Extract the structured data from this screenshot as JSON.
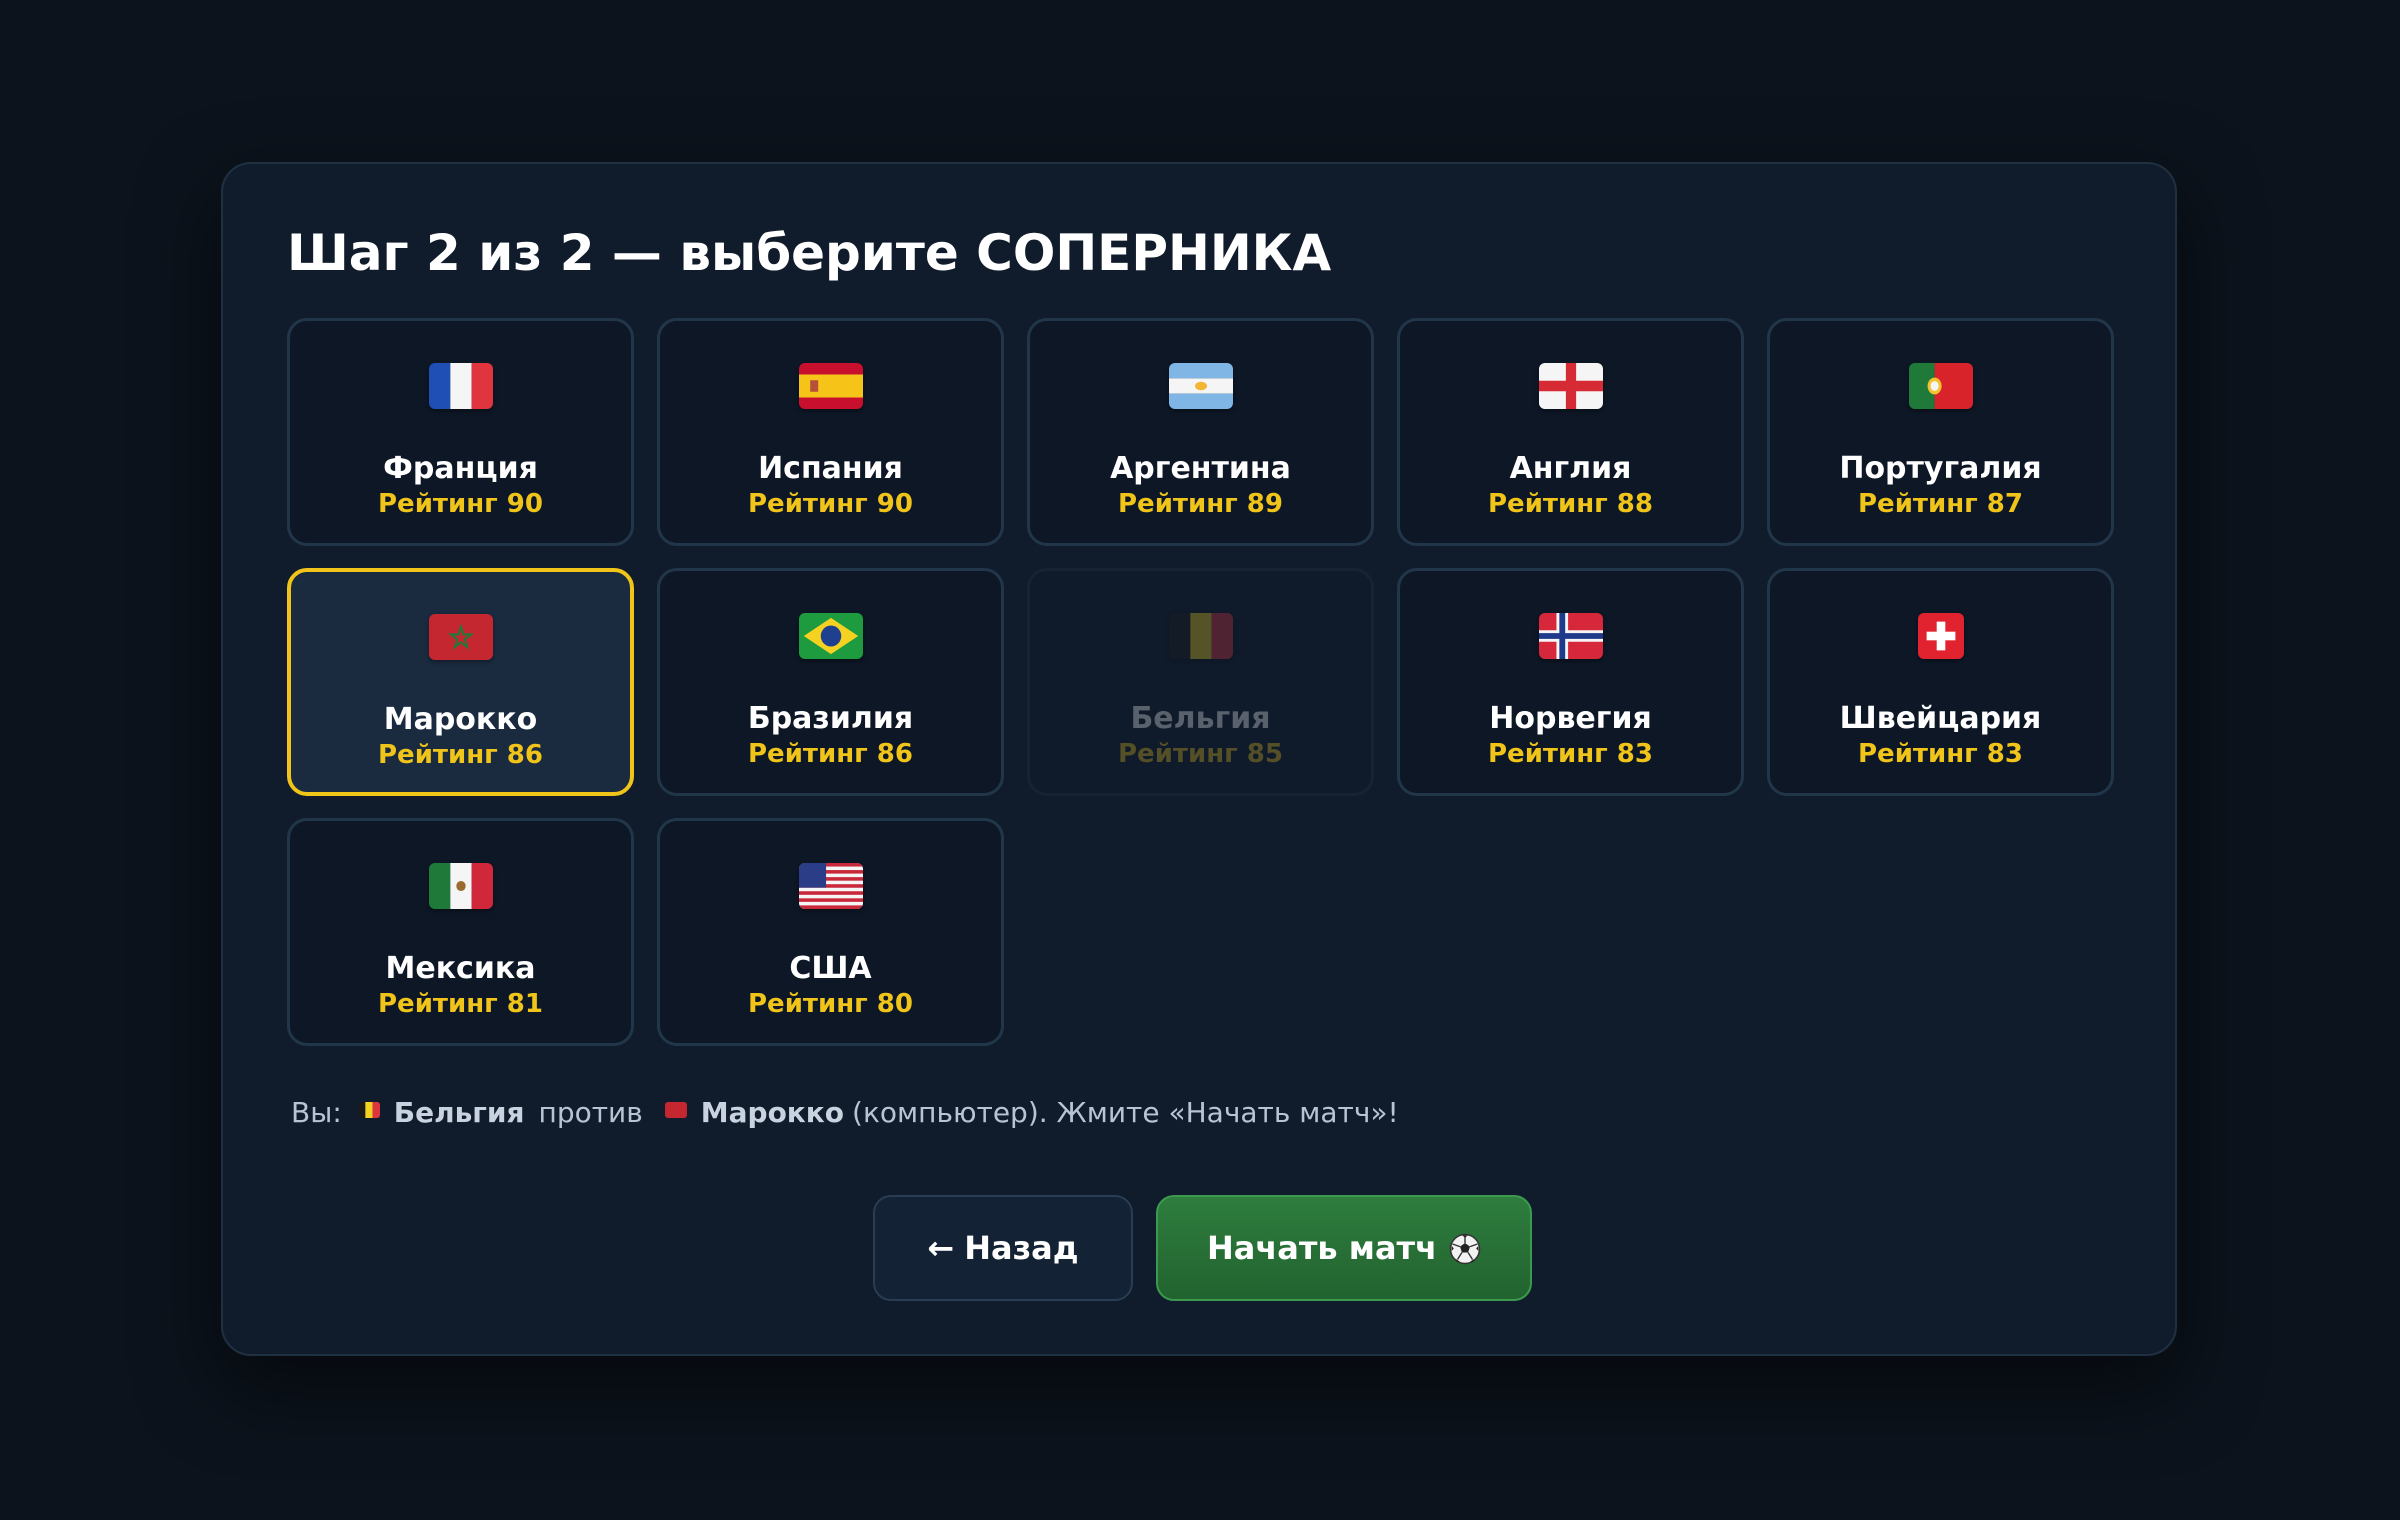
{
  "title": "Шаг 2 из 2 — выберите СОПЕРНИКА",
  "rating_prefix": "Рейтинг",
  "teams": [
    {
      "name": "Франция",
      "rating": "Рейтинг 90",
      "flag": "flag-france-icon",
      "state": "normal"
    },
    {
      "name": "Испания",
      "rating": "Рейтинг 90",
      "flag": "flag-spain-icon",
      "state": "normal"
    },
    {
      "name": "Аргентина",
      "rating": "Рейтинг 89",
      "flag": "flag-argentina-icon",
      "state": "normal"
    },
    {
      "name": "Англия",
      "rating": "Рейтинг 88",
      "flag": "flag-england-icon",
      "state": "normal"
    },
    {
      "name": "Португалия",
      "rating": "Рейтинг 87",
      "flag": "flag-portugal-icon",
      "state": "normal"
    },
    {
      "name": "Марокко",
      "rating": "Рейтинг 86",
      "flag": "flag-morocco-icon",
      "state": "selected"
    },
    {
      "name": "Бразилия",
      "rating": "Рейтинг 86",
      "flag": "flag-brazil-icon",
      "state": "normal"
    },
    {
      "name": "Бельгия",
      "rating": "Рейтинг 85",
      "flag": "flag-belgium-icon",
      "state": "disabled"
    },
    {
      "name": "Норвегия",
      "rating": "Рейтинг 83",
      "flag": "flag-norway-icon",
      "state": "normal"
    },
    {
      "name": "Швейцария",
      "rating": "Рейтинг 83",
      "flag": "flag-switzerland-icon",
      "state": "normal"
    },
    {
      "name": "Мексика",
      "rating": "Рейтинг 81",
      "flag": "flag-mexico-icon",
      "state": "normal"
    },
    {
      "name": "США",
      "rating": "Рейтинг 80",
      "flag": "flag-usa-icon",
      "state": "normal"
    }
  ],
  "summary": {
    "you_label": "Вы:",
    "you_team": "Бельгия",
    "vs_word": "против",
    "opponent_team": "Марокко",
    "tail": "(компьютер). Жмите «Начать матч»!"
  },
  "buttons": {
    "back_arrow": "←",
    "back_label": "Назад",
    "start_label": "Начать матч",
    "start_icon": "soccer-ball-icon"
  },
  "colors": {
    "background": "#0c131c",
    "panel": "#101c2c",
    "card": "#0d1726",
    "card_border": "#22364a",
    "selected_card": "#1a2b40",
    "accent_yellow": "#f0c419",
    "start_green": "#2e7d3e"
  }
}
